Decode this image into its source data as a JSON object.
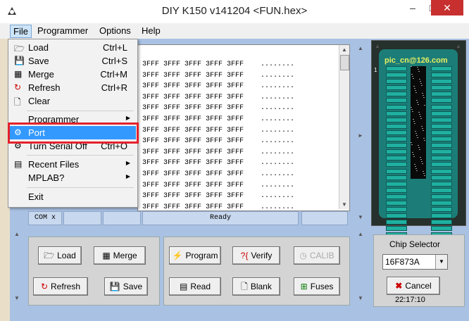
{
  "window": {
    "title": "DIY K150 v141204  <FUN.hex>",
    "controls": [
      "–",
      "□",
      "✕"
    ]
  },
  "menubar": [
    "File",
    "Programmer",
    "Options",
    "Help"
  ],
  "file_menu": {
    "items": [
      {
        "label": "Load",
        "shortcut": "Ctrl+L"
      },
      {
        "label": "Save",
        "shortcut": "Ctrl+S"
      },
      {
        "label": "Merge",
        "shortcut": "Ctrl+M"
      },
      {
        "label": "Refresh",
        "shortcut": "Ctrl+R"
      },
      {
        "label": "Clear",
        "shortcut": ""
      },
      {
        "label": "Programmer",
        "shortcut": ""
      },
      {
        "label": "Port",
        "shortcut": ""
      },
      {
        "label": "Turn Serial Off",
        "shortcut": "Ctrl+O"
      },
      {
        "label": "Recent Files",
        "shortcut": ""
      },
      {
        "label": "MPLAB?",
        "shortcut": ""
      },
      {
        "label": "Exit",
        "shortcut": ""
      }
    ],
    "highlighted": "Port"
  },
  "hex": {
    "line": "3FFF 3FFF 3FFF 3FFF 3FFF    ........",
    "count": 15
  },
  "status": {
    "com": "COM x",
    "message": "Ready"
  },
  "chip": {
    "label": "pic_cn@126.com",
    "pin1": "1",
    "selector_title": "Chip Selector",
    "selected": "16F873A"
  },
  "buttons": {
    "load": "Load",
    "merge": "Merge",
    "refresh": "Refresh",
    "save": "Save",
    "program": "Program",
    "verify": "Verify",
    "calib": "CALIB",
    "read": "Read",
    "blank": "Blank",
    "fuses": "Fuses",
    "cancel": "Cancel"
  },
  "clock": "22:17:10",
  "colors": {
    "highlight": "#3399ff",
    "callout": "#e3222d",
    "board": "#1c7d78"
  }
}
